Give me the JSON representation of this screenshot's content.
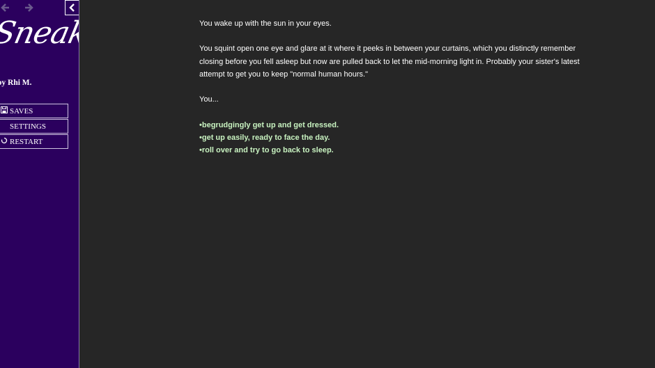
{
  "sidebar": {
    "title": "Sneaker",
    "byline": "by Rhi M.",
    "menu": [
      {
        "label": "SAVES",
        "icon": "floppy-disk-icon"
      },
      {
        "label": "SETTINGS",
        "icon": "gear-icon"
      },
      {
        "label": "RESTART",
        "icon": "restart-icon"
      }
    ]
  },
  "passage": {
    "paragraphs": [
      "You wake up with the sun in your eyes.",
      "You squint open one eye and glare at it where it peeks in between your curtains, which you distinctly remember closing before you fell asleep but now are pulled back to let the mid-morning light in. Probably your sister's latest attempt to get you to keep \"normal human hours.\"",
      "You..."
    ],
    "choices": [
      "•begrudgingly get up and get dressed.",
      "•get up easily, ready to face the day.",
      "•roll over and try to go back to sleep."
    ]
  },
  "colors": {
    "sidebar_bg": "#2b005e",
    "main_bg": "#262626",
    "link": "#c8f2c0",
    "text": "#ffffff"
  }
}
